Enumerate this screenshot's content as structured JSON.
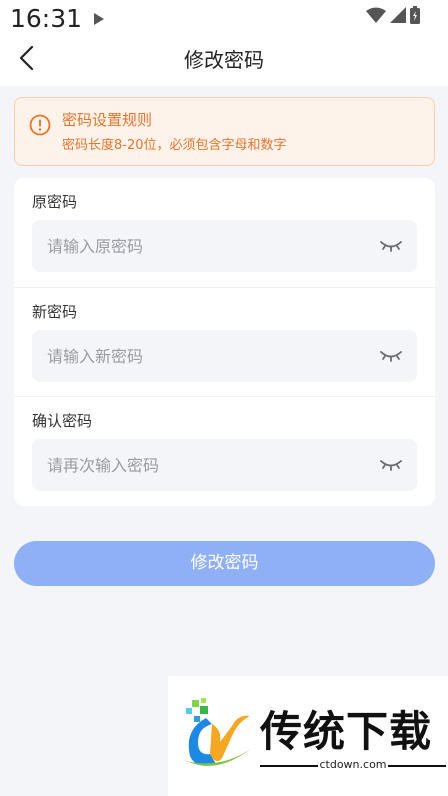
{
  "status_bar": {
    "time": "16:31"
  },
  "nav": {
    "title": "修改密码"
  },
  "notice": {
    "title": "密码设置规则",
    "description": "密码长度8-20位，必须包含字母和数字",
    "color": "#e8732b"
  },
  "fields": [
    {
      "label": "原密码",
      "placeholder": "请输入原密码",
      "value": ""
    },
    {
      "label": "新密码",
      "placeholder": "请输入新密码",
      "value": ""
    },
    {
      "label": "确认密码",
      "placeholder": "请再次输入密码",
      "value": ""
    }
  ],
  "submit": {
    "label": "修改密码",
    "color": "#8fb0f4"
  },
  "watermark": {
    "brand": "传统下载",
    "url": "ctdown.com"
  }
}
